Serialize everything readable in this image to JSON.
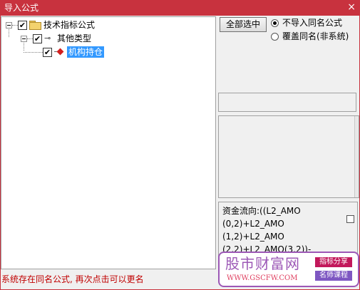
{
  "window": {
    "title": "导入公式",
    "close_label": "×"
  },
  "tree": {
    "root": {
      "label": "技术指标公式",
      "checked": "✔",
      "expander": "-"
    },
    "group": {
      "label": "其他类型",
      "checked": "✔",
      "expander": "-"
    },
    "item": {
      "label": "机构持仓",
      "checked": "✔",
      "selected": true
    }
  },
  "options": {
    "select_all_label": "全部选中",
    "radios": [
      {
        "label": "不导入同名公式",
        "selected": true
      },
      {
        "label": "覆盖同名(非系统)",
        "selected": false
      }
    ]
  },
  "info": {
    "lines": [
      "资金流向:((L2_AMO",
      "(0,2)+L2_AMO",
      "(1,2)+L2_AMO",
      "(2,2)+L2_AMO(3,2))-"
    ]
  },
  "status": {
    "message": "系统存在同名公式, 再次点击可以更名"
  },
  "watermark": {
    "brand": "股市财富网",
    "url": "WWW.GSCFW.COM",
    "tag1": "指标分享",
    "tag2": "名师课程"
  },
  "colors": {
    "titlebar": "#c8323e",
    "selection": "#3399ff",
    "status_text": "#c00000",
    "watermark_accent": "#9c58b6"
  }
}
